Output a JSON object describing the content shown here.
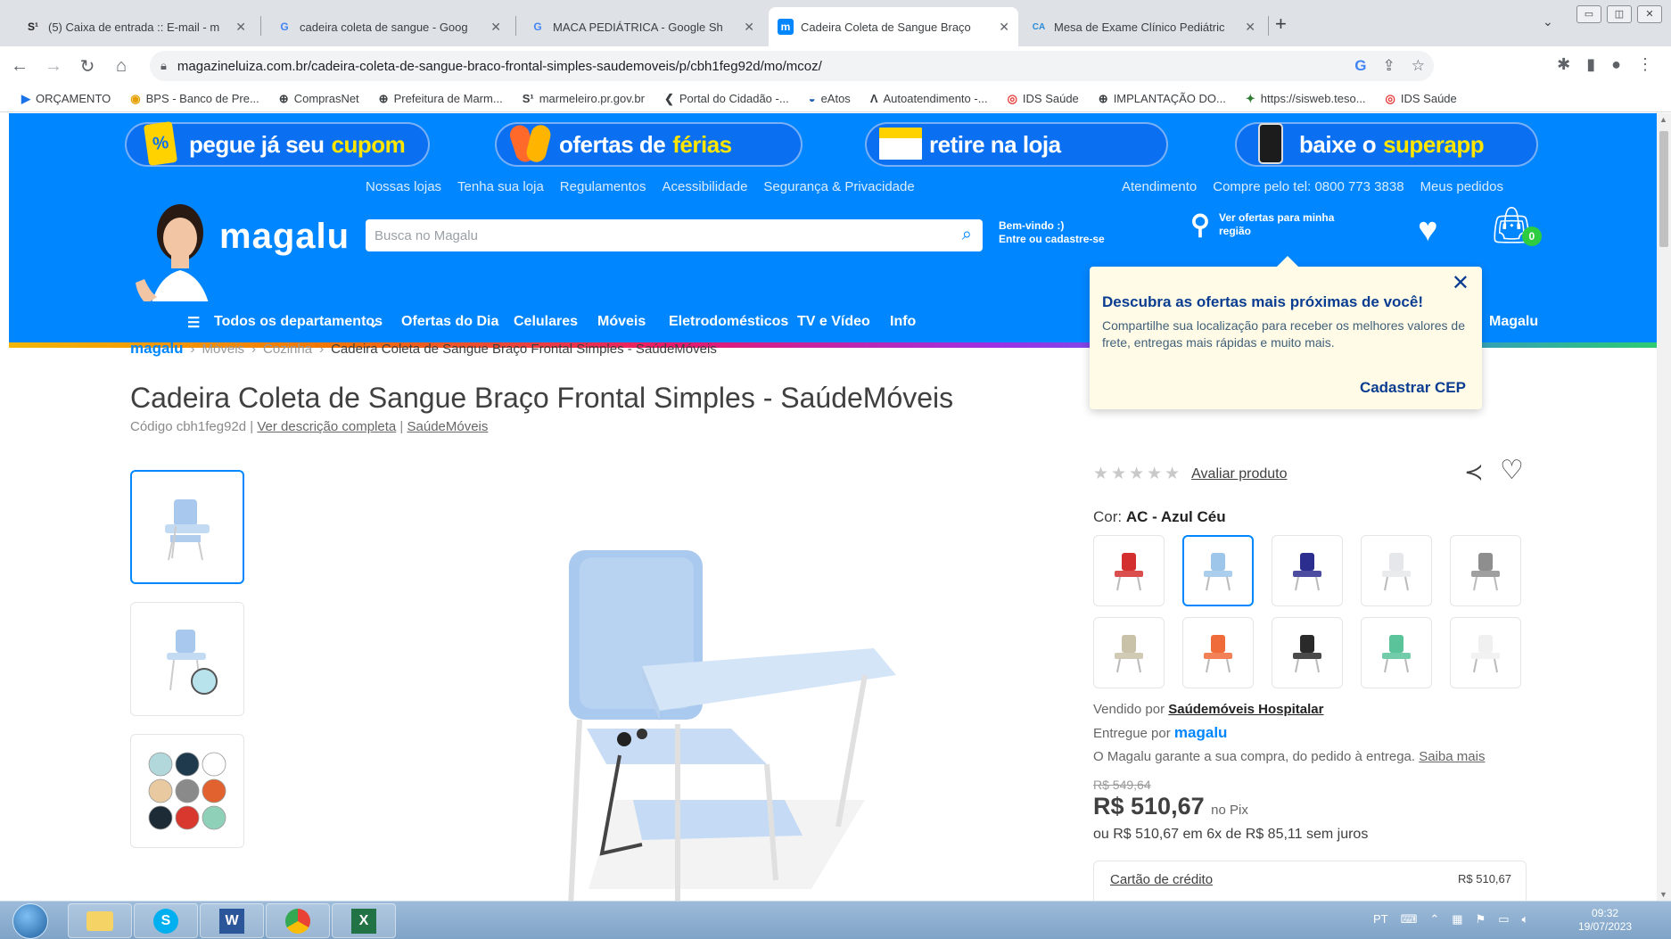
{
  "browser": {
    "tabs": [
      {
        "icon": "S¹",
        "title": "(5) Caixa de entrada :: E-mail - m"
      },
      {
        "icon": "G",
        "title": "cadeira coleta de sangue - Goog"
      },
      {
        "icon": "G",
        "title": "MACA PEDIÁTRICA - Google Sh"
      },
      {
        "icon": "m",
        "title": "Cadeira Coleta de Sangue Braço"
      },
      {
        "icon": "CA",
        "title": "Mesa de Exame Clínico Pediátric"
      }
    ],
    "url": "magazineluiza.com.br/cadeira-coleta-de-sangue-braco-frontal-simples-saudemoveis/p/cbh1feg92d/mo/mcoz/",
    "bookmarks": [
      "ORÇAMENTO",
      "BPS - Banco de Pre...",
      "ComprasNet",
      "Prefeitura de Marm...",
      "marmeleiro.pr.gov.br",
      "Portal do Cidadão -...",
      "eAtos",
      "Autoatendimento -...",
      "IDS Saúde",
      "IMPLANTAÇÃO DO...",
      "https://sisweb.teso...",
      "IDS Saúde"
    ]
  },
  "promo": {
    "cupom": {
      "main": "pegue já seu",
      "hl": "cupom"
    },
    "ferias": {
      "main": "ofertas de",
      "hl": "férias"
    },
    "loja": {
      "main": "retire na loja",
      "hl": ""
    },
    "app": {
      "main": "baixe o",
      "hl": "superapp"
    }
  },
  "util_links_left": [
    "Nossas lojas",
    "Tenha sua loja",
    "Regulamentos",
    "Acessibilidade",
    "Segurança & Privacidade"
  ],
  "util_links_right": [
    "Atendimento",
    "Compre pelo tel: 0800 773 3838",
    "Meus pedidos"
  ],
  "header": {
    "logo": "magalu",
    "search_placeholder": "Busca no Magalu",
    "welcome1": "Bem-vindo :)",
    "welcome2": "Entre ou cadastre-se",
    "loc1": "Ver ofertas para minha",
    "loc2": "região",
    "cart_count": "0"
  },
  "categories": [
    "Todos os departamentos",
    "Ofertas do Dia",
    "Celulares",
    "Móveis",
    "Eletrodomésticos",
    "TV e Vídeo",
    "Info",
    "Magalu"
  ],
  "popup": {
    "title": "Descubra as ofertas mais próximas de você!",
    "body": "Compartilhe sua localização para receber os melhores valores de frete, entregas mais rápidas e muito mais.",
    "link": "Cadastrar CEP"
  },
  "breadcrumb": {
    "home": "magalu",
    "l1": "Móveis",
    "l2": "Cozinha",
    "current": "Cadeira Coleta de Sangue Braço Frontal Simples - SaúdeMóveis"
  },
  "product": {
    "title": "Cadeira Coleta de Sangue Braço Frontal Simples - SaúdeMóveis",
    "code": "Código cbh1feg92d |",
    "desc_link": "Ver descrição completa",
    "brand_link": "SaúdeMóveis",
    "rating_link": "Avaliar produto",
    "rating": 0,
    "color_label": "Cor:",
    "color_value": "AC - Azul Céu",
    "seller_label": "Vendido por",
    "seller": "Saúdemóveis Hospitalar",
    "delivered_label": "Entregue por",
    "delivered_by": "magalu",
    "guarantee": "O Magalu garante a sua compra, do pedido à entrega.",
    "guarantee_link": "Saiba mais",
    "old_price": "R$ 549,64",
    "price": "R$ 510,67",
    "price_suffix": "no Pix",
    "installments": "ou R$ 510,67 em 6x de R$ 85,11 sem juros",
    "card_label": "Cartão de crédito",
    "card_value": "R$ 510,67"
  },
  "swatch_colors": [
    "#d32f2f",
    "#9ec5ea",
    "#2b2d8f",
    "#e5e7ea",
    "#8e8e8e",
    "#c9c2a8",
    "#f06b3a",
    "#2a2a2a",
    "#5bc39a",
    "#f0f0f0"
  ],
  "palette_colors": [
    "#b3d8dc",
    "#1f3a4d",
    "#ffffff",
    "#e8c9a0",
    "#8a8a8a",
    "#e2622f",
    "#1d2b36",
    "#d8382e",
    "#8fd1b8"
  ],
  "taskbar": {
    "tray": "PT",
    "time": "09:32",
    "date": "19/07/2023"
  }
}
